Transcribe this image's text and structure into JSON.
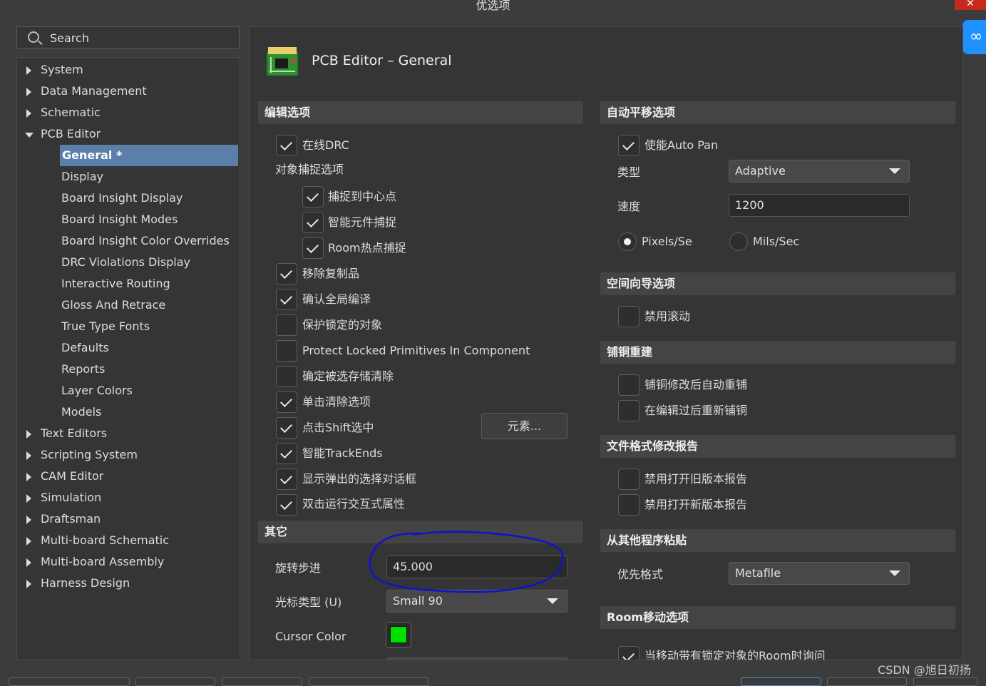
{
  "window": {
    "title": "优选项",
    "close_glyph": "✕"
  },
  "search": {
    "placeholder": "Search"
  },
  "tree": [
    {
      "label": "System",
      "expandable": true,
      "level": 0
    },
    {
      "label": "Data Management",
      "expandable": true,
      "level": 0
    },
    {
      "label": "Schematic",
      "expandable": true,
      "level": 0
    },
    {
      "label": "PCB Editor",
      "expandable": true,
      "expanded": true,
      "level": 0
    },
    {
      "label": "General *",
      "level": 1,
      "selected": true
    },
    {
      "label": "Display",
      "level": 1
    },
    {
      "label": "Board Insight Display",
      "level": 1
    },
    {
      "label": "Board Insight Modes",
      "level": 1
    },
    {
      "label": "Board Insight Color Overrides",
      "level": 1
    },
    {
      "label": "DRC Violations Display",
      "level": 1
    },
    {
      "label": "Interactive Routing",
      "level": 1
    },
    {
      "label": "Gloss And Retrace",
      "level": 1
    },
    {
      "label": "True Type Fonts",
      "level": 1
    },
    {
      "label": "Defaults",
      "level": 1
    },
    {
      "label": "Reports",
      "level": 1
    },
    {
      "label": "Layer Colors",
      "level": 1
    },
    {
      "label": "Models",
      "level": 1
    },
    {
      "label": "Text Editors",
      "expandable": true,
      "level": 0
    },
    {
      "label": "Scripting System",
      "expandable": true,
      "level": 0
    },
    {
      "label": "CAM Editor",
      "expandable": true,
      "level": 0
    },
    {
      "label": "Simulation",
      "expandable": true,
      "level": 0
    },
    {
      "label": "Draftsman",
      "expandable": true,
      "level": 0
    },
    {
      "label": "Multi-board Schematic",
      "expandable": true,
      "level": 0
    },
    {
      "label": "Multi-board Assembly",
      "expandable": true,
      "level": 0
    },
    {
      "label": "Harness Design",
      "expandable": true,
      "level": 0
    }
  ],
  "page": {
    "title": "PCB Editor – General",
    "icon": "pcb-board-icon"
  },
  "edit_options": {
    "header": "编辑选项",
    "online_drc": {
      "label": "在线DRC",
      "checked": true
    },
    "snap_group_label": "对象捕捉选项",
    "snap_center": {
      "label": "捕捉到中心点",
      "checked": true
    },
    "smart_component_snap": {
      "label": "智能元件捕捉",
      "checked": true
    },
    "room_hotspot_snap": {
      "label": "Room热点捕捉",
      "checked": true
    },
    "remove_duplicates": {
      "label": "移除复制品",
      "checked": true
    },
    "confirm_global_edit": {
      "label": "确认全局编译",
      "checked": true
    },
    "protect_locked": {
      "label": "保护锁定的对象",
      "checked": false
    },
    "protect_locked_primitives": {
      "label": "Protect Locked Primitives In Component",
      "checked": false
    },
    "confirm_clear_selection_memory": {
      "label": "确定被选存储清除",
      "checked": false
    },
    "click_clears_selection": {
      "label": "单击清除选项",
      "checked": true
    },
    "shift_click_select": {
      "label": "点击Shift选中",
      "checked": true
    },
    "elements_button": "元素...",
    "smart_track_ends": {
      "label": "智能TrackEnds",
      "checked": true
    },
    "show_popup_selection": {
      "label": "显示弹出的选择对话框",
      "checked": true
    },
    "double_click_inspector": {
      "label": "双击运行交互式属性",
      "checked": true
    }
  },
  "other": {
    "header": "其它",
    "rotation_step_label": "旋转步进",
    "rotation_step_value": "45.000",
    "cursor_type_label": "光标类型 (U)",
    "cursor_type_value": "Small 90",
    "cursor_color_label": "Cursor Color",
    "cursor_color": "#00e000"
  },
  "autopan": {
    "header": "自动平移选项",
    "enable": {
      "label": "使能Auto Pan",
      "checked": true
    },
    "type_label": "类型",
    "type_value": "Adaptive",
    "speed_label": "速度",
    "speed_value": "1200",
    "unit_pixels": "Pixels/Sec",
    "unit_mils": "Mils/Sec",
    "selected_unit": "Pixels/Sec"
  },
  "space_navigator": {
    "header": "空间向导选项",
    "disable_roll": {
      "label": "禁用滚动",
      "checked": false
    }
  },
  "polygon_rebuild": {
    "header": "铺铜重建",
    "repour_after_modify": {
      "label": "铺铜修改后自动重铺",
      "checked": false
    },
    "repour_after_edit": {
      "label": "在编辑过后重新铺铜",
      "checked": false
    }
  },
  "file_format_report": {
    "header": "文件格式修改报告",
    "disable_old_report": {
      "label": "禁用打开旧版本报告",
      "checked": false
    },
    "disable_new_report": {
      "label": "禁用打开新版本报告",
      "checked": false
    }
  },
  "paste": {
    "header": "从其他程序粘贴",
    "preferred_format_label": "优先格式",
    "preferred_format_value": "Metafile"
  },
  "room_move": {
    "header": "Room移动选项",
    "ask_when_locked": {
      "label": "当移动带有锁定对象的Room时询问",
      "checked": true
    }
  },
  "annotation": {
    "color": "#1010d0",
    "shape": "ellipse-around-rotation-step"
  },
  "watermark": "CSDN @旭日初扬",
  "colors": {
    "accent_selected": "#5b7fa8",
    "close_red": "#c42b1c",
    "badge_blue": "#1e90ff"
  }
}
